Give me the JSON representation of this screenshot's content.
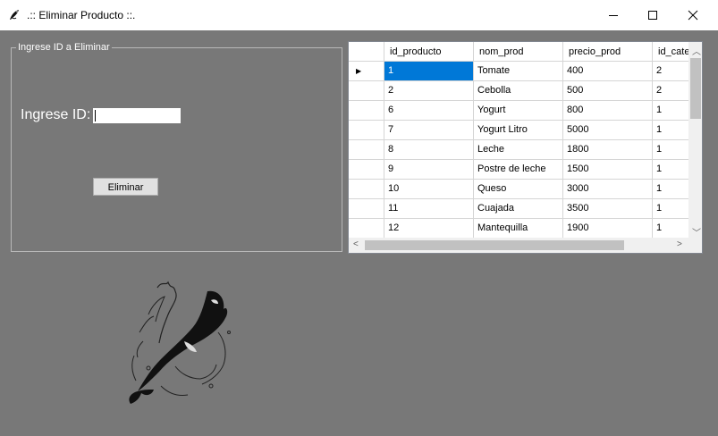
{
  "window": {
    "title": ".:: Eliminar Producto ::."
  },
  "form": {
    "group_label": "Ingrese ID a Eliminar",
    "id_label": "Ingrese ID:",
    "id_value": "",
    "delete_button": "Eliminar"
  },
  "grid": {
    "columns": [
      "id_producto",
      "nom_prod",
      "precio_prod",
      "id_cate"
    ],
    "rows": [
      {
        "id": "1",
        "nombre": "Tomate",
        "precio": "400",
        "cat": "2"
      },
      {
        "id": "2",
        "nombre": "Cebolla",
        "precio": "500",
        "cat": "2"
      },
      {
        "id": "6",
        "nombre": "Yogurt",
        "precio": "800",
        "cat": "1"
      },
      {
        "id": "7",
        "nombre": "Yogurt Litro",
        "precio": "5000",
        "cat": "1"
      },
      {
        "id": "8",
        "nombre": "Leche",
        "precio": "1800",
        "cat": "1"
      },
      {
        "id": "9",
        "nombre": "Postre de leche",
        "precio": "1500",
        "cat": "1"
      },
      {
        "id": "10",
        "nombre": "Queso",
        "precio": "3000",
        "cat": "1"
      },
      {
        "id": "11",
        "nombre": "Cuajada",
        "precio": "3500",
        "cat": "1"
      },
      {
        "id": "12",
        "nombre": "Mantequilla",
        "precio": "1900",
        "cat": "1"
      }
    ],
    "selected_row": 0
  },
  "colors": {
    "form_bg": "#787878",
    "selection": "#0078d7"
  },
  "icons": [
    "orca-app-icon",
    "minimize-icon",
    "maximize-icon",
    "close-icon",
    "row-pointer-icon",
    "orca-illustration"
  ]
}
